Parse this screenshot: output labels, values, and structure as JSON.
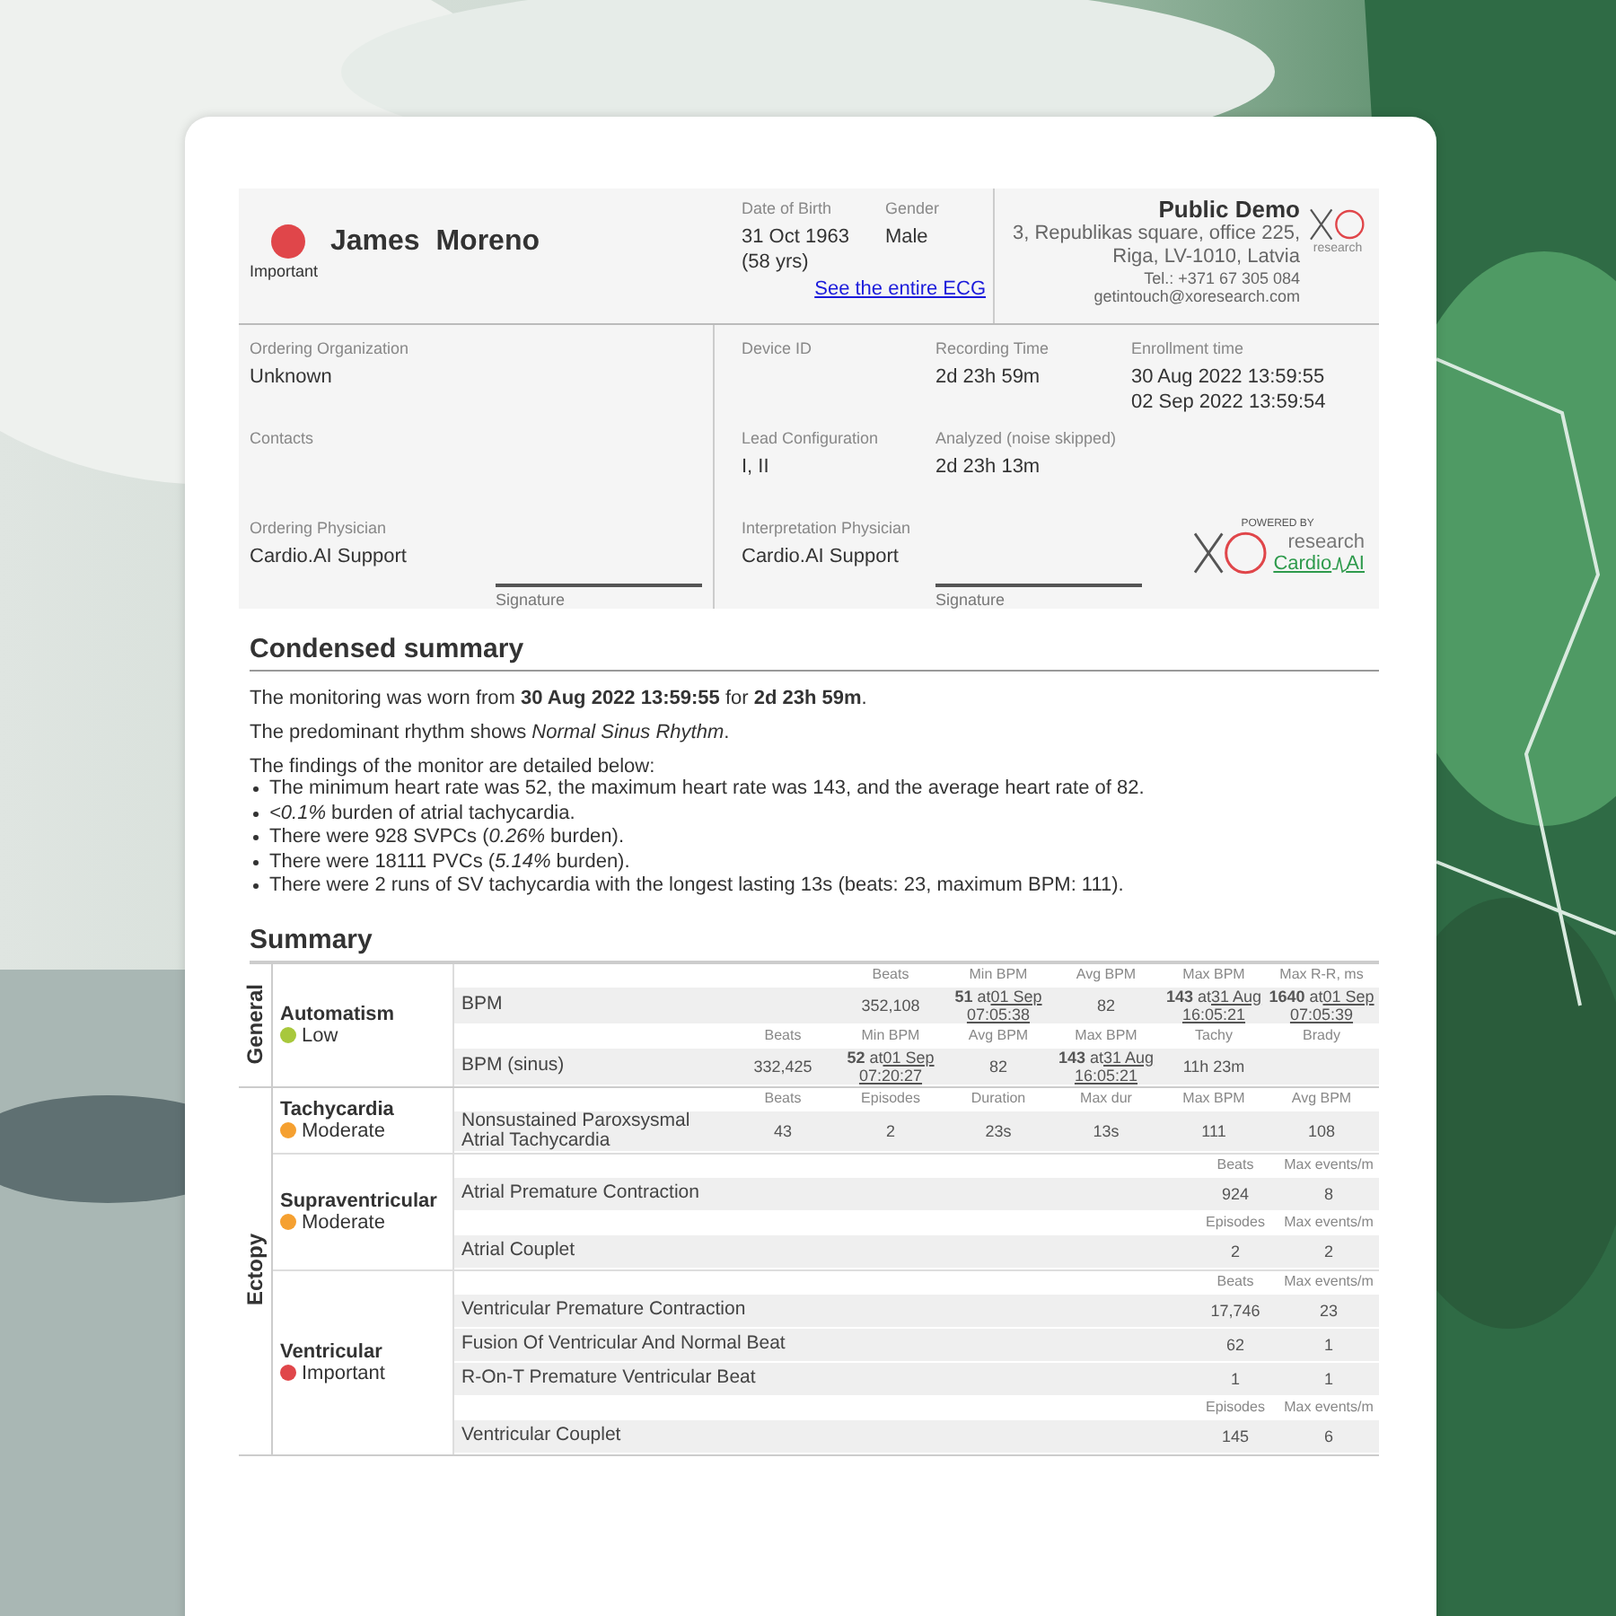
{
  "patient": {
    "name": "James  Moreno",
    "status": {
      "label": "Important",
      "color": "#e0464a"
    }
  },
  "birth": {
    "label": "Date of Birth",
    "value": "31 Oct 1963",
    "age": "(58 yrs)"
  },
  "gender": {
    "label": "Gender",
    "value": "Male"
  },
  "ecg_link": "See the entire ECG",
  "organization": {
    "name": "Public Demo",
    "address": [
      "3, Republikas square, office 225,",
      "Riga, LV-1010, Latvia"
    ],
    "phone": "Tel.: +371 67 305 084",
    "email": "getintouch@xoresearch.com",
    "logo_text": "research"
  },
  "left_fields": [
    {
      "label": "Ordering Organization",
      "values": [
        "Unknown"
      ]
    },
    {
      "label": "Contacts"
    },
    {
      "label": "Ordering Physician",
      "values": [
        "Cardio.AI Support"
      ],
      "signature": "Signature"
    }
  ],
  "right_fields": [
    {
      "label": "Device ID"
    },
    {
      "label": "Recording Time",
      "values": [
        "2d 23h 59m"
      ]
    },
    {
      "label": "Enrollment time",
      "values": [
        "30 Aug 2022 13:59:55",
        "02 Sep 2022 13:59:54"
      ]
    },
    {
      "label": "Lead Configuration",
      "values": [
        "I, II"
      ]
    },
    {
      "label": "Analyzed (noise skipped)",
      "values": [
        "2d 23h 13m"
      ]
    }
  ],
  "interpretation": {
    "label": "Interpretation Physician",
    "values": [
      "Cardio.AI Support"
    ],
    "signature": "Signature"
  },
  "powered_by": {
    "caption": "POWERED BY",
    "brand": "research",
    "product": [
      "Cardio",
      "AI"
    ]
  },
  "condensed": {
    "title": "Condensed summary",
    "paragraphs": [
      "The monitoring was worn from **30 Aug 2022 13:59:55** for **2d 23h 59m**.",
      "The predominant rhythm shows *Normal Sinus Rhythm*."
    ],
    "intro": "The findings of the monitor are detailed below:",
    "bullets": [
      "The minimum heart rate was 52, the maximum heart rate was 143, and the average heart rate of 82.",
      "*<0.1%* burden of atrial tachycardia.",
      "There were 928 SVPCs (*0.26%* burden).",
      "There were 18111 PVCs (*5.14%* burden).",
      "There were 2 runs of SV tachycardia with the longest lasting 13s (beats: 23, maximum BPM: 111)."
    ]
  },
  "summary": {
    "title": "Summary",
    "groups": [
      {
        "label": "General",
        "categories": [
          {
            "name": "Automatism",
            "level": {
              "label": "Low",
              "color": "#a8c83c"
            },
            "blocks": [
              {
                "columns": [
                  "Beats",
                  "Min BPM",
                  "Avg BPM",
                  "Max BPM",
                  "Max R-R, ms"
                ],
                "rows": [
                  {
                    "name": "BPM",
                    "cells": [
                      {
                        "text": "352,108"
                      },
                      {
                        "text": "**51** at",
                        "date": "01 Sep 07:05:38"
                      },
                      {
                        "text": "82"
                      },
                      {
                        "text": "**143** at",
                        "date": "31 Aug 16:05:21"
                      },
                      {
                        "text": "**1640** at",
                        "date": "01 Sep 07:05:39"
                      }
                    ]
                  }
                ]
              },
              {
                "columns": [
                  "Beats",
                  "Min BPM",
                  "Avg BPM",
                  "Max BPM",
                  "Tachy",
                  "Brady"
                ],
                "rows": [
                  {
                    "name": "BPM (sinus)",
                    "cells": [
                      {
                        "text": "332,425"
                      },
                      {
                        "text": "**52** at",
                        "date": "01 Sep 07:20:27"
                      },
                      {
                        "text": "82"
                      },
                      {
                        "text": "**143** at",
                        "date": "31 Aug 16:05:21"
                      },
                      {
                        "text": "11h 23m"
                      }
                    ]
                  }
                ]
              }
            ]
          }
        ]
      },
      {
        "label": "Ectopy",
        "categories": [
          {
            "name": "Tachycardia",
            "level": {
              "label": "Moderate",
              "color": "#f5a030"
            },
            "blocks": [
              {
                "columns": [
                  "Beats",
                  "Episodes",
                  "Duration",
                  "Max dur",
                  "Max BPM",
                  "Avg BPM"
                ],
                "rows": [
                  {
                    "name": "Nonsustained Paroxsysmal Atrial Tachycardia",
                    "cells": [
                      {
                        "text": "43"
                      },
                      {
                        "text": "2"
                      },
                      {
                        "text": "23s"
                      },
                      {
                        "text": "13s"
                      },
                      {
                        "text": "111"
                      },
                      {
                        "text": "108"
                      }
                    ]
                  }
                ]
              }
            ]
          },
          {
            "name": "Supraventricular",
            "level": {
              "label": "Moderate",
              "color": "#f5a030"
            },
            "blocks": [
              {
                "columns": [
                  "Beats",
                  "Max events/m"
                ],
                "rows": [
                  {
                    "name": "Atrial Premature Contraction",
                    "cells": [
                      {
                        "text": "924"
                      },
                      {
                        "text": "8"
                      }
                    ]
                  }
                ]
              },
              {
                "columns": [
                  "Episodes",
                  "Max events/m"
                ],
                "rows": [
                  {
                    "name": "Atrial Couplet",
                    "cells": [
                      {
                        "text": "2"
                      },
                      {
                        "text": "2"
                      }
                    ]
                  }
                ]
              }
            ]
          },
          {
            "name": "Ventricular",
            "level": {
              "label": "Important",
              "color": "#e0464a"
            },
            "blocks": [
              {
                "columns": [
                  "Beats",
                  "Max events/m"
                ],
                "rows": [
                  {
                    "name": "Ventricular Premature Contraction",
                    "cells": [
                      {
                        "text": "17,746"
                      },
                      {
                        "text": "23"
                      }
                    ]
                  },
                  {
                    "name": "Fusion Of Ventricular And Normal Beat",
                    "cells": [
                      {
                        "text": "62"
                      },
                      {
                        "text": "1"
                      }
                    ]
                  },
                  {
                    "name": "R-On-T Premature Ventricular Beat",
                    "cells": [
                      {
                        "text": "1"
                      },
                      {
                        "text": "1"
                      }
                    ]
                  }
                ]
              },
              {
                "columns": [
                  "Episodes",
                  "Max events/m"
                ],
                "rows": [
                  {
                    "name": "Ventricular Couplet",
                    "cells": [
                      {
                        "text": "145"
                      },
                      {
                        "text": "6"
                      }
                    ]
                  }
                ]
              }
            ]
          }
        ]
      }
    ]
  }
}
